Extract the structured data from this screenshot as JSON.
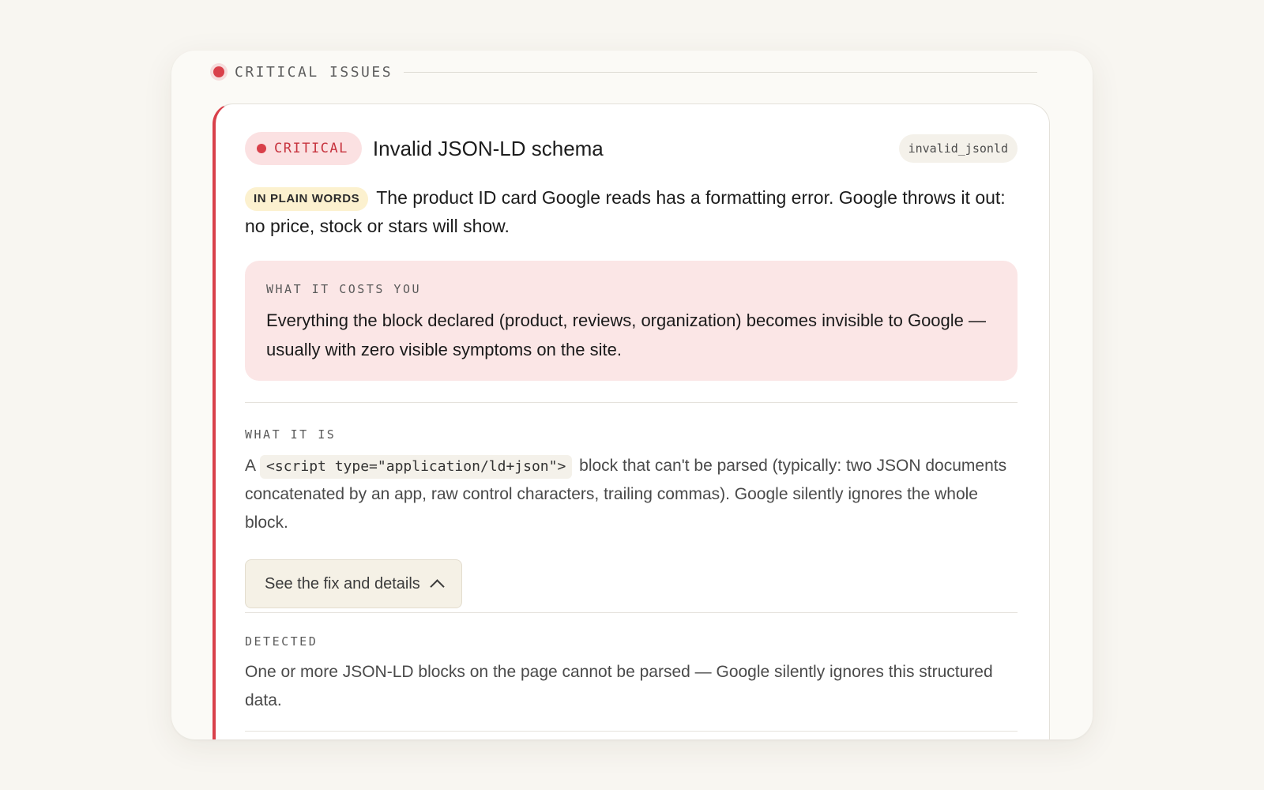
{
  "section": {
    "title": "CRITICAL ISSUES"
  },
  "issue": {
    "severity": "CRITICAL",
    "title": "Invalid JSON-LD schema",
    "code": "invalid_jsonld",
    "plain_label": "IN PLAIN WORDS",
    "plain_text": "The product ID card Google reads has a formatting error. Google throws it out: no price, stock or stars will show.",
    "cost_label": "WHAT IT COSTS YOU",
    "cost_text": "Everything the block declared (product, reviews, organization) becomes invisible to Google — usually with zero visible symptoms on the site.",
    "what_label": "WHAT IT IS",
    "what_prefix": "A",
    "what_code": "<script type=\"application/ld+json\">",
    "what_suffix": "block that can't be parsed (typically: two JSON documents concatenated by an app, raw control characters, trailing commas). Google silently ignores the whole block.",
    "fix_button_label": "See the fix and details",
    "detected_label": "DETECTED",
    "detected_text": "One or more JSON-LD blocks on the page cannot be parsed — Google silently ignores this structured data."
  },
  "icons": {
    "severity_dot": "red-dot-icon",
    "fix_toggle": "chevron-up-icon"
  },
  "colors": {
    "critical": "#d9404a",
    "critical_bg": "#fbe1e2",
    "cost_bg": "#fbe6e6",
    "plain_badge_bg": "#fcf1cf"
  }
}
